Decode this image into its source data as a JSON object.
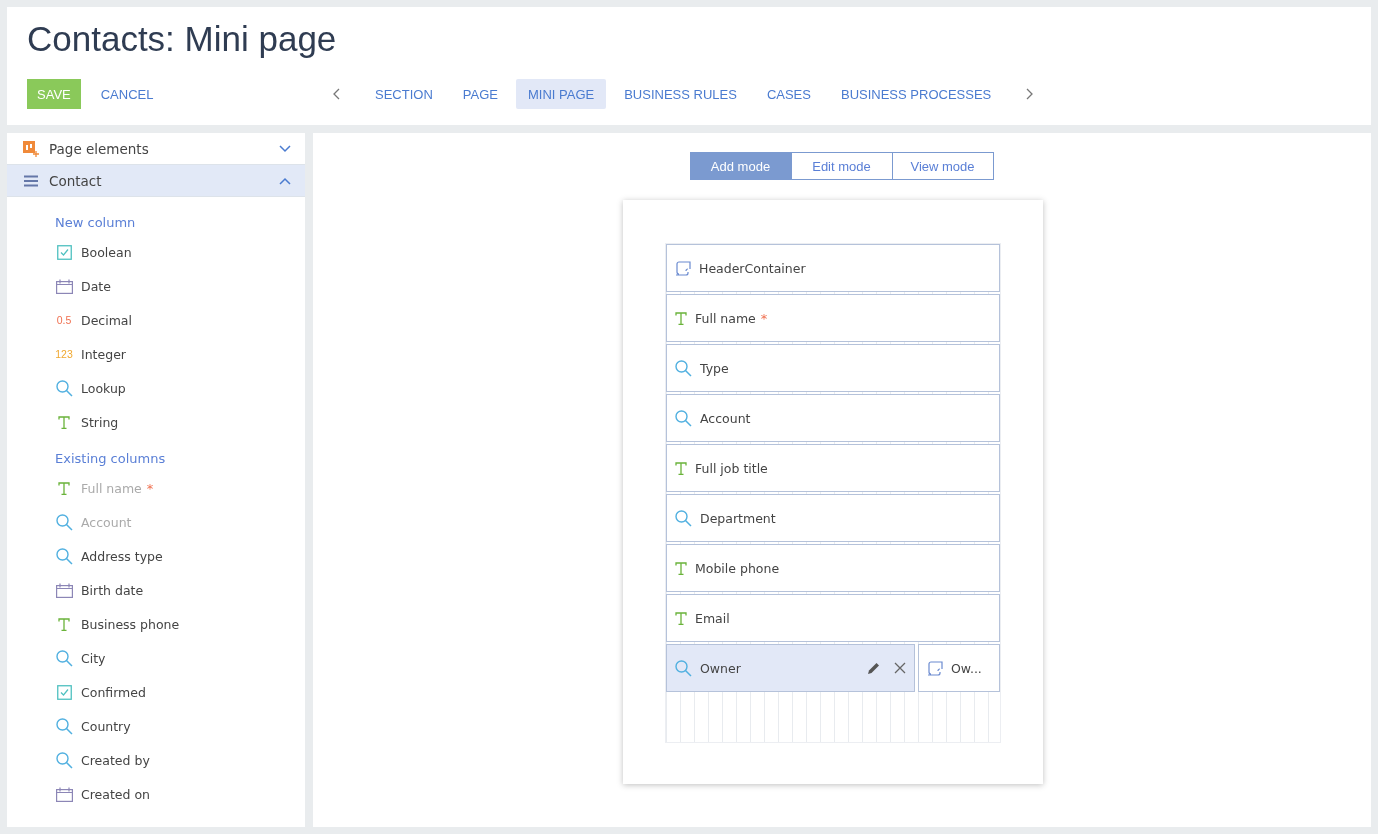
{
  "title": "Contacts: Mini page",
  "actions": [
    {
      "label": "SAVE",
      "kind": "primary"
    },
    {
      "label": "CANCEL",
      "kind": "link"
    }
  ],
  "tabs": [
    {
      "label": "SECTION",
      "selected": false
    },
    {
      "label": "PAGE",
      "selected": false
    },
    {
      "label": "MINI PAGE",
      "selected": true
    },
    {
      "label": "BUSINESS RULES",
      "selected": false
    },
    {
      "label": "CASES",
      "selected": false
    },
    {
      "label": "BUSINESS PROCESSES",
      "selected": false
    }
  ],
  "sidebar": {
    "panels": [
      {
        "label": "Page elements",
        "kind": "elements",
        "expanded": false
      },
      {
        "label": "Contact",
        "kind": "object",
        "expanded": true
      }
    ],
    "groups": [
      {
        "title": "New column",
        "items": [
          {
            "label": "Boolean",
            "kind": "boolean",
            "disabled": false
          },
          {
            "label": "Date",
            "kind": "date",
            "disabled": false
          },
          {
            "label": "Decimal",
            "kind": "decimal",
            "icon_text": "0.5",
            "disabled": false
          },
          {
            "label": "Integer",
            "kind": "integer",
            "icon_text": "123",
            "disabled": false
          },
          {
            "label": "Lookup",
            "kind": "lookup",
            "disabled": false
          },
          {
            "label": "String",
            "kind": "text",
            "disabled": false
          }
        ]
      },
      {
        "title": "Existing columns",
        "items": [
          {
            "label": "Full name",
            "kind": "text",
            "mark": "*",
            "disabled": true
          },
          {
            "label": "Account",
            "kind": "lookup",
            "disabled": true
          },
          {
            "label": "Address type",
            "kind": "lookup",
            "disabled": false
          },
          {
            "label": "Birth date",
            "kind": "date",
            "disabled": false
          },
          {
            "label": "Business phone",
            "kind": "text",
            "disabled": false
          },
          {
            "label": "City",
            "kind": "lookup",
            "disabled": false
          },
          {
            "label": "Confirmed",
            "kind": "boolean",
            "disabled": false
          },
          {
            "label": "Country",
            "kind": "lookup",
            "disabled": false
          },
          {
            "label": "Created by",
            "kind": "lookup",
            "disabled": false
          },
          {
            "label": "Created on",
            "kind": "date",
            "disabled": false
          }
        ]
      }
    ]
  },
  "modes": [
    {
      "label": "Add mode",
      "selected": true
    },
    {
      "label": "Edit mode",
      "selected": false
    },
    {
      "label": "View mode",
      "selected": false
    }
  ],
  "rows": [
    [
      {
        "label": "HeaderContainer",
        "kind": "container",
        "selected": false
      }
    ],
    [
      {
        "label": "Full name",
        "kind": "text",
        "mark": "*",
        "selected": false
      }
    ],
    [
      {
        "label": "Type",
        "kind": "lookup",
        "selected": false
      }
    ],
    [
      {
        "label": "Account",
        "kind": "lookup",
        "selected": false
      }
    ],
    [
      {
        "label": "Full job title",
        "kind": "text",
        "selected": false
      }
    ],
    [
      {
        "label": "Department",
        "kind": "lookup",
        "selected": false
      }
    ],
    [
      {
        "label": "Mobile phone",
        "kind": "text",
        "selected": false
      }
    ],
    [
      {
        "label": "Email",
        "kind": "text",
        "selected": false
      }
    ],
    [
      {
        "label": "Owner",
        "kind": "lookup",
        "selected": true
      },
      {
        "label": "Ow...",
        "kind": "container",
        "selected": false
      }
    ]
  ]
}
